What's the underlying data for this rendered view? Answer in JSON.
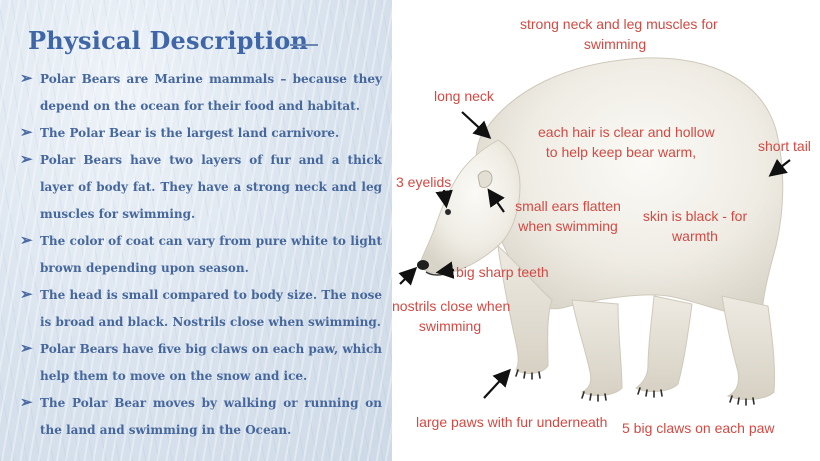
{
  "slide": {
    "title": "Physical Description",
    "bullets": [
      "Polar Bears are Marine mammals – because they depend on the ocean for their food and habitat.",
      "The Polar Bear is the largest land carnivore.",
      "Polar Bears have two layers of fur and a thick layer of body fat. They have a strong neck and leg muscles for swimming.",
      "The color of coat can vary from pure white to light brown depending upon season.",
      "The head is small compared to body size. The nose is broad and black. Nostrils close when swimming.",
      "Polar Bears have five big claws on each paw, which help them to move on the snow and ice.",
      "The Polar Bear moves by walking or running on the land and swimming in the Ocean."
    ]
  },
  "diagram": {
    "labels": {
      "neck_legs": "strong neck and leg muscles for\nswimming",
      "long_neck": "long neck",
      "hair": "each hair is clear and hollow\nto help keep bear warm,",
      "short_tail": "short tail",
      "eyelids": "3 eyelids",
      "ears": "small ears flatten\nwhen swimming",
      "skin": "skin is black - for\nwarmth",
      "teeth": "big sharp teeth",
      "nostrils": "nostrils close when\nswimming",
      "paws": "large paws with fur underneath",
      "claws": "5 big claws on each paw"
    }
  },
  "colors": {
    "title": "#3f67a8",
    "bullet_text": "#46679c",
    "label": "#d14a43"
  }
}
